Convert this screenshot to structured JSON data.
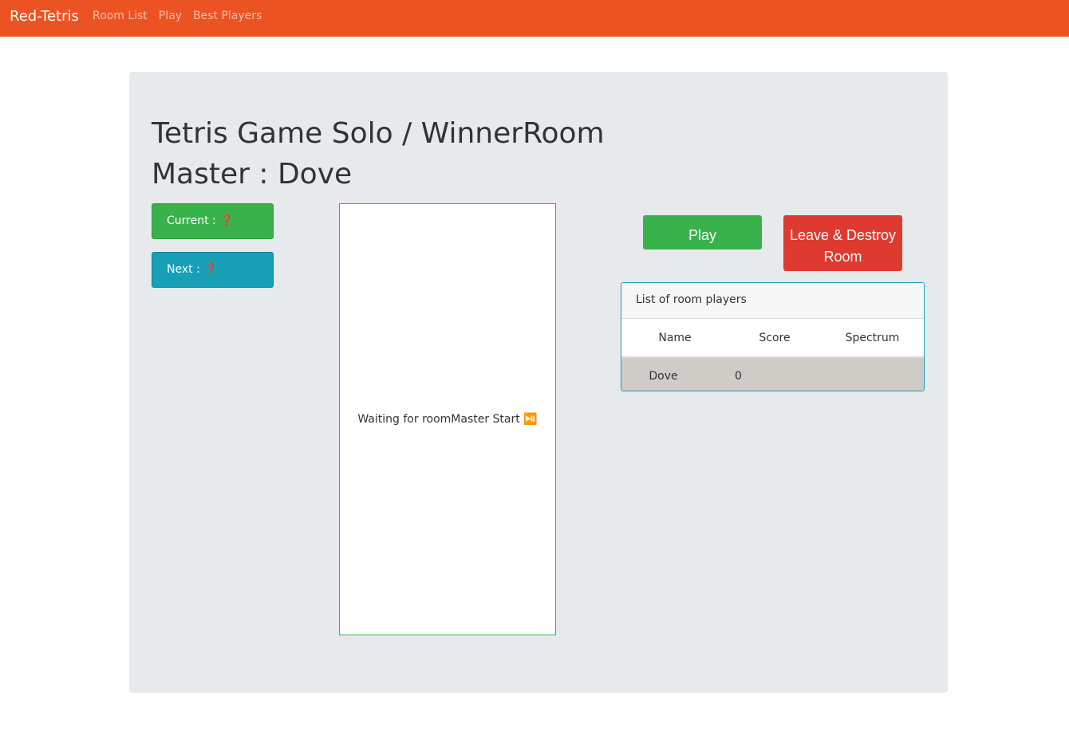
{
  "colors": {
    "navbar_bg": "#eb5323",
    "panel_bg": "#e7eaed",
    "green": "#38b24a",
    "teal": "#179fb5",
    "red": "#df3a2f",
    "row_bg": "#cfccc8"
  },
  "navbar": {
    "brand": "Red-Tetris",
    "links": [
      {
        "label": "Room List"
      },
      {
        "label": "Play"
      },
      {
        "label": "Best Players"
      }
    ]
  },
  "game": {
    "title": "Tetris Game Solo / WinnerRoom Master : Dove",
    "current_label": "Current : ❓",
    "next_label": "Next : ❓",
    "board_message": "Waiting for roomMaster Start ⏯️"
  },
  "actions": {
    "play_label": "Play",
    "leave_label": "Leave & Destroy Room"
  },
  "players_card": {
    "header": "List of room players",
    "columns": [
      "Name",
      "Score",
      "Spectrum"
    ],
    "rows": [
      {
        "name": "Dove",
        "score": "0",
        "spectrum": ""
      }
    ]
  }
}
